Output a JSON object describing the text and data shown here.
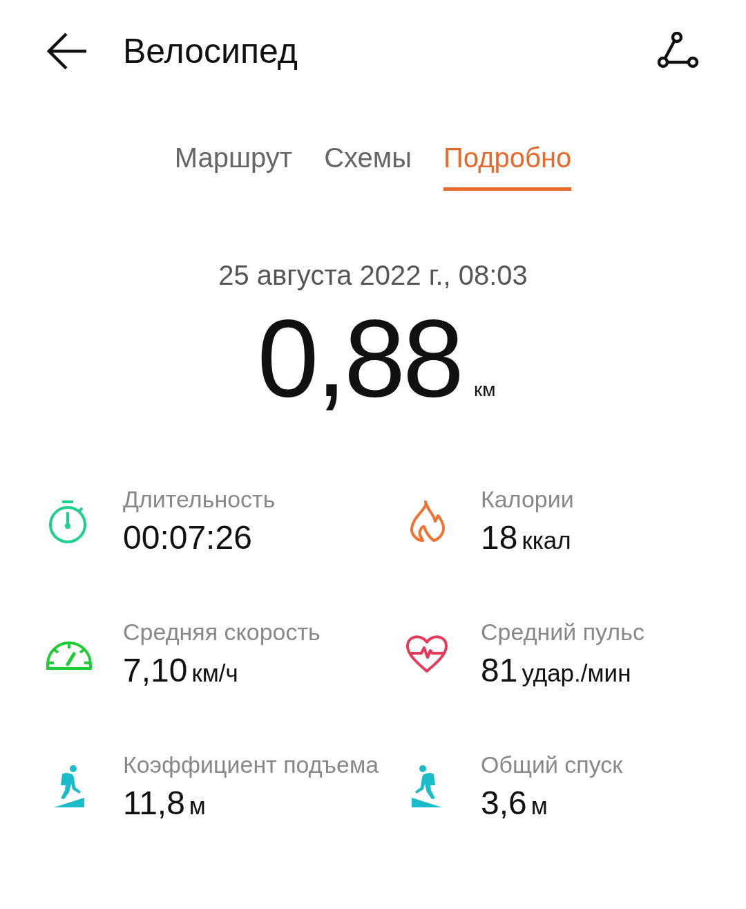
{
  "header": {
    "title": "Велосипед"
  },
  "tabs": [
    {
      "label": "Маршрут",
      "selected": false
    },
    {
      "label": "Схемы",
      "selected": false
    },
    {
      "label": "Подробно",
      "selected": true
    }
  ],
  "date": "25 августа 2022 г., 08:03",
  "distance": {
    "value": "0,88",
    "unit": "км"
  },
  "stats": [
    {
      "kind": "stopwatch",
      "label": "Длительность",
      "value": "00:07:26"
    },
    {
      "kind": "flame",
      "label": "Калории",
      "value": "18",
      "unit": "ккал"
    },
    {
      "kind": "gauge",
      "label": "Средняя скорость",
      "value": "7,10",
      "unit": "км/ч"
    },
    {
      "kind": "heart",
      "label": "Средний пульс",
      "value": "81",
      "unit": "удар./мин"
    },
    {
      "kind": "climb",
      "label": "Коэффициент подъема",
      "value": "11,8",
      "unit": "м"
    },
    {
      "kind": "descent",
      "label": "Общий спуск",
      "value": "3,6",
      "unit": "м"
    }
  ]
}
